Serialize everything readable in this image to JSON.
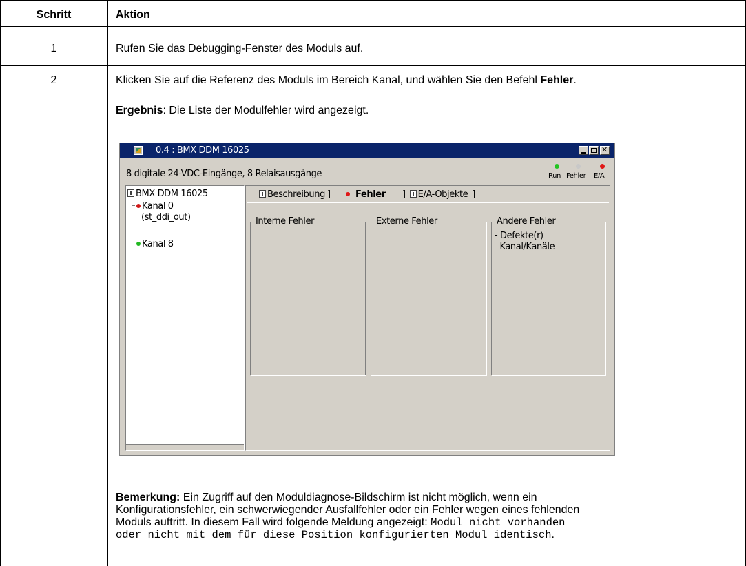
{
  "table": {
    "header": {
      "step": "Schritt",
      "action": "Aktion"
    },
    "rows": [
      {
        "step": "1",
        "action": "Rufen Sie das Debugging-Fenster des Moduls auf."
      },
      {
        "step": "2",
        "action_part1": "Klicken Sie auf die Referenz des Moduls im Bereich Kanal, und wählen Sie den Befehl ",
        "action_bold": "Fehler",
        "action_part2": ".",
        "result_label": "Ergebnis",
        "result_text": ": Die Liste der Modulfehler wird angezeigt.",
        "note_label": "Bemerkung:",
        "note_line1": " Ein Zugriff auf den Moduldiagnose-Bildschirm ist nicht möglich, wenn ein",
        "note_line2": "Konfigurationsfehler, ein schwerwiegender Ausfallfehler oder ein Fehler wegen eines fehlenden",
        "note_line3": "Moduls auftritt. In diesem Fall wird folgende Meldung angezeigt: ",
        "note_code1": "Modul nicht vorhanden",
        "note_code2": "oder nicht mit dem für diese Position konfigurierten Modul identisch",
        "note_end": "."
      }
    ]
  },
  "window": {
    "title": "0.4 : BMX DDM 16025",
    "subtitle": "8 digitale 24-VDC-Eingänge, 8 Relaisausgänge",
    "leds": [
      {
        "label": "Run",
        "color": "#22c422"
      },
      {
        "label": "Fehler",
        "color": "#c8c8c8"
      },
      {
        "label": "E/A",
        "color": "#e01818"
      }
    ],
    "tree": {
      "root": "BMX DDM 16025",
      "channels": [
        {
          "label": "Kanal 0",
          "sublabel": "(st_ddi_out)",
          "color": "#d01818"
        },
        {
          "label": "Kanal 8",
          "color": "#22b822"
        }
      ]
    },
    "tabs": [
      "Beschreibung",
      "Fehler",
      "E/A-Objekte"
    ],
    "active_tab": "Fehler",
    "groups": {
      "internal": {
        "title": "Interne Fehler",
        "body": ""
      },
      "external": {
        "title": "Externe Fehler",
        "body": ""
      },
      "other": {
        "title": "Andere Fehler",
        "line1": "- Defekte(r)",
        "line2": "  Kanal/Kanäle"
      }
    }
  }
}
